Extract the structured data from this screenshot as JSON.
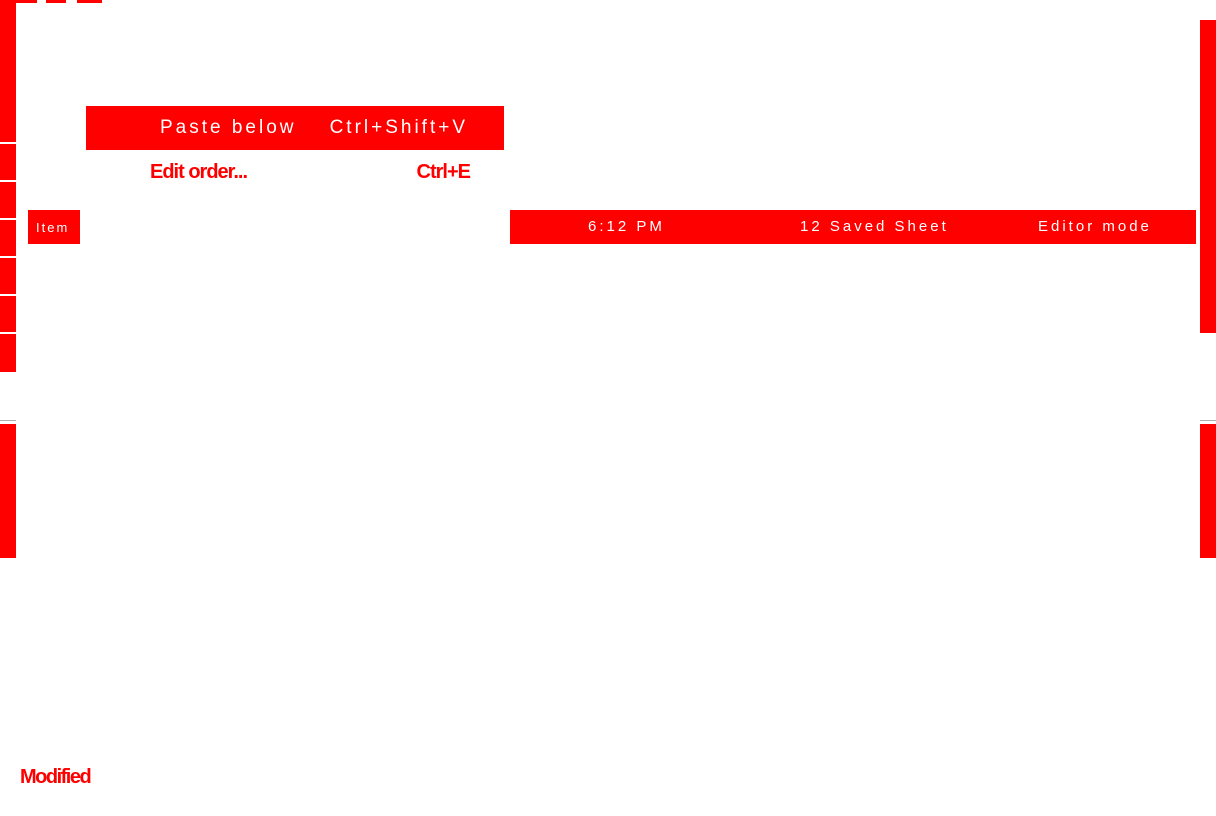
{
  "menu": {
    "highlighted_label": "Paste below",
    "highlighted_shortcut": "Ctrl+Shift+V",
    "edit_order_label": "Edit order...",
    "edit_order_shortcut": "Ctrl+E"
  },
  "toolbar": {
    "left_label": "Item",
    "band_labels": [
      "6:12 PM",
      "12 Saved Sheet",
      "Editor mode"
    ]
  },
  "status": {
    "text": "Modified"
  },
  "colors": {
    "accent": "#ff0000",
    "background": "#ffffff",
    "divider": "#b0b0b0"
  }
}
